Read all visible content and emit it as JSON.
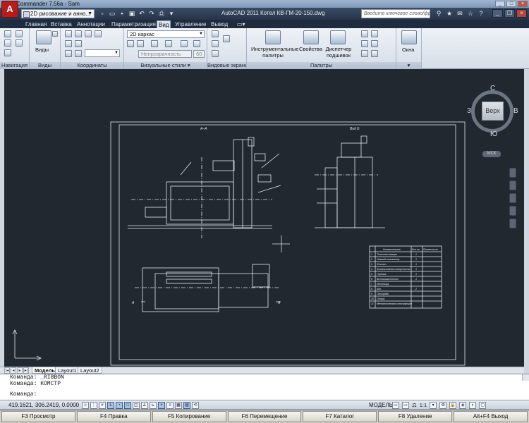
{
  "outer_window": {
    "title": "Total Commander 7.56a - Sam"
  },
  "autocad": {
    "app_button": "A",
    "workspace": "2D рисование и анно...",
    "doc_title": "AutoCAD 2011    Котел КВ-ГМ-20-150.dwg",
    "search_placeholder": "Введите ключевое слово/фразу"
  },
  "ribbon_tabs": [
    "Главная",
    "Вставка",
    "Аннотации",
    "Параметризация",
    "Вид",
    "Управление",
    "Вывод"
  ],
  "active_tab": "Вид",
  "panels": {
    "navigation": "Навигация",
    "views": "Виды",
    "views_btn": "Виды",
    "coordinates": "Координаты",
    "visual_styles": "Визуальные стили",
    "visual_style_value": "2D каркас",
    "opacity_label": "Непрозрачность",
    "opacity_value": "60",
    "viewports": "Видовые экраны",
    "palettes": "Палитры",
    "tool_palettes": "Инструментальные палитры",
    "properties": "Свойства",
    "sheet_set_manager": "Диспетчер подшивок",
    "windows": "Окна"
  },
  "viewcube": {
    "top": "С",
    "left": "З",
    "right": "В",
    "bottom": "Ю",
    "face": "Верх",
    "wcs": "МСК"
  },
  "drawing": {
    "section_aa": "А–А",
    "view_b": "Вид Б",
    "marker_a": "А",
    "table_header": [
      "Наименование",
      "Кол-во",
      "Примечание"
    ],
    "table_rows": [
      [
        "1",
        "Топочная камера",
        "1"
      ],
      [
        "2",
        "Нижний коллектор",
        "1"
      ],
      [
        "3",
        "Фестон",
        "1"
      ],
      [
        "4",
        "Конвективная поверхность",
        "1"
      ],
      [
        "5",
        "Горелка",
        "1"
      ],
      [
        "6",
        "Вспомогательное",
        "1"
      ],
      [
        "7",
        "Лестница",
        ""
      ],
      [
        "8",
        "Шт.",
        "2"
      ],
      [
        "9",
        "Площадки",
        ""
      ],
      [
        "10",
        "Опоры",
        ""
      ],
      [
        "11",
        "Металлическая конструкция",
        ""
      ]
    ]
  },
  "layout_tabs": [
    "Модель",
    "Layout1",
    "Layout2"
  ],
  "command_lines": [
    "Команда: _RIBBON",
    "Команда: КОМСТР",
    "Команда:"
  ],
  "status": {
    "coords": "419.1621, 306.2419, 0.0000",
    "model": "МОДЕЛЬ",
    "scale": "1:1"
  },
  "fkeys": [
    "F3 Просмотр",
    "F4 Правка",
    "F5 Копирование",
    "F6 Перемещение",
    "F7 Каталог",
    "F8 Удаление",
    "Alt+F4 Выход"
  ]
}
